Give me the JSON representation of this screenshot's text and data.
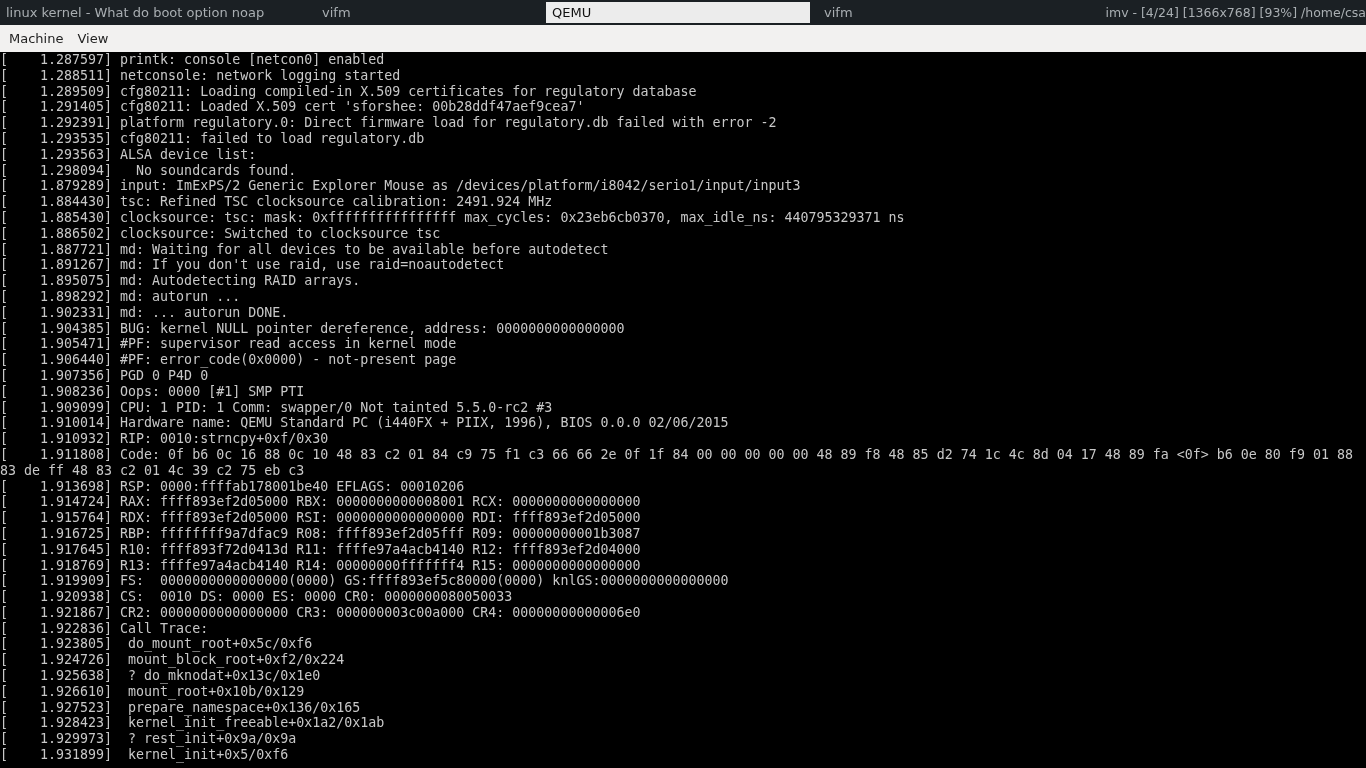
{
  "taskbar": [
    {
      "label": "linux kernel - What do boot option noap",
      "selected": false
    },
    {
      "label": "vifm",
      "selected": false
    },
    {
      "label": "QEMU",
      "selected": true
    },
    {
      "label": "vifm",
      "selected": false
    },
    {
      "label": "imv - [4/24] [1366x768] [93%] /home/csa",
      "selected": false
    }
  ],
  "menu": [
    "Machine",
    "View"
  ],
  "console": [
    "[    1.287597] printk: console [netcon0] enabled",
    "[    1.288511] netconsole: network logging started",
    "[    1.289509] cfg80211: Loading compiled-in X.509 certificates for regulatory database",
    "[    1.291405] cfg80211: Loaded X.509 cert 'sforshee: 00b28ddf47aef9cea7'",
    "[    1.292391] platform regulatory.0: Direct firmware load for regulatory.db failed with error -2",
    "[    1.293535] cfg80211: failed to load regulatory.db",
    "[    1.293563] ALSA device list:",
    "[    1.298094]   No soundcards found.",
    "[    1.879289] input: ImExPS/2 Generic Explorer Mouse as /devices/platform/i8042/serio1/input/input3",
    "[    1.884430] tsc: Refined TSC clocksource calibration: 2491.924 MHz",
    "[    1.885430] clocksource: tsc: mask: 0xffffffffffffffff max_cycles: 0x23eb6cb0370, max_idle_ns: 440795329371 ns",
    "[    1.886502] clocksource: Switched to clocksource tsc",
    "[    1.887721] md: Waiting for all devices to be available before autodetect",
    "[    1.891267] md: If you don't use raid, use raid=noautodetect",
    "[    1.895075] md: Autodetecting RAID arrays.",
    "[    1.898292] md: autorun ...",
    "[    1.902331] md: ... autorun DONE.",
    "[    1.904385] BUG: kernel NULL pointer dereference, address: 0000000000000000",
    "[    1.905471] #PF: supervisor read access in kernel mode",
    "[    1.906440] #PF: error_code(0x0000) - not-present page",
    "[    1.907356] PGD 0 P4D 0",
    "[    1.908236] Oops: 0000 [#1] SMP PTI",
    "[    1.909099] CPU: 1 PID: 1 Comm: swapper/0 Not tainted 5.5.0-rc2 #3",
    "[    1.910014] Hardware name: QEMU Standard PC (i440FX + PIIX, 1996), BIOS 0.0.0 02/06/2015",
    "[    1.910932] RIP: 0010:strncpy+0xf/0x30",
    "[    1.911808] Code: 0f b6 0c 16 88 0c 10 48 83 c2 01 84 c9 75 f1 c3 66 66 2e 0f 1f 84 00 00 00 00 00 48 89 f8 48 85 d2 74 1c 4c 8d 04 17 48 89 fa <0f> b6 0e 80 f9 01 88",
    "83 de ff 48 83 c2 01 4c 39 c2 75 eb c3",
    "[    1.913698] RSP: 0000:ffffab178001be40 EFLAGS: 00010206",
    "[    1.914724] RAX: ffff893ef2d05000 RBX: 0000000000008001 RCX: 0000000000000000",
    "[    1.915764] RDX: ffff893ef2d05000 RSI: 0000000000000000 RDI: ffff893ef2d05000",
    "[    1.916725] RBP: ffffffff9a7dfac9 R08: ffff893ef2d05fff R09: 00000000001b3087",
    "[    1.917645] R10: ffff893f72d0413d R11: ffffe97a4acb4140 R12: ffff893ef2d04000",
    "[    1.918769] R13: ffffe97a4acb4140 R14: 00000000fffffff4 R15: 0000000000000000",
    "[    1.919909] FS:  0000000000000000(0000) GS:ffff893ef5c80000(0000) knlGS:0000000000000000",
    "[    1.920938] CS:  0010 DS: 0000 ES: 0000 CR0: 0000000080050033",
    "[    1.921867] CR2: 0000000000000000 CR3: 000000003c00a000 CR4: 00000000000006e0",
    "[    1.922836] Call Trace:",
    "[    1.923805]  do_mount_root+0x5c/0xf6",
    "[    1.924726]  mount_block_root+0xf2/0x224",
    "[    1.925638]  ? do_mknodat+0x13c/0x1e0",
    "[    1.926610]  mount_root+0x10b/0x129",
    "[    1.927523]  prepare_namespace+0x136/0x165",
    "[    1.928423]  kernel_init_freeable+0x1a2/0x1ab",
    "[    1.929973]  ? rest_init+0x9a/0x9a",
    "[    1.931899]  kernel_init+0x5/0xf6"
  ]
}
